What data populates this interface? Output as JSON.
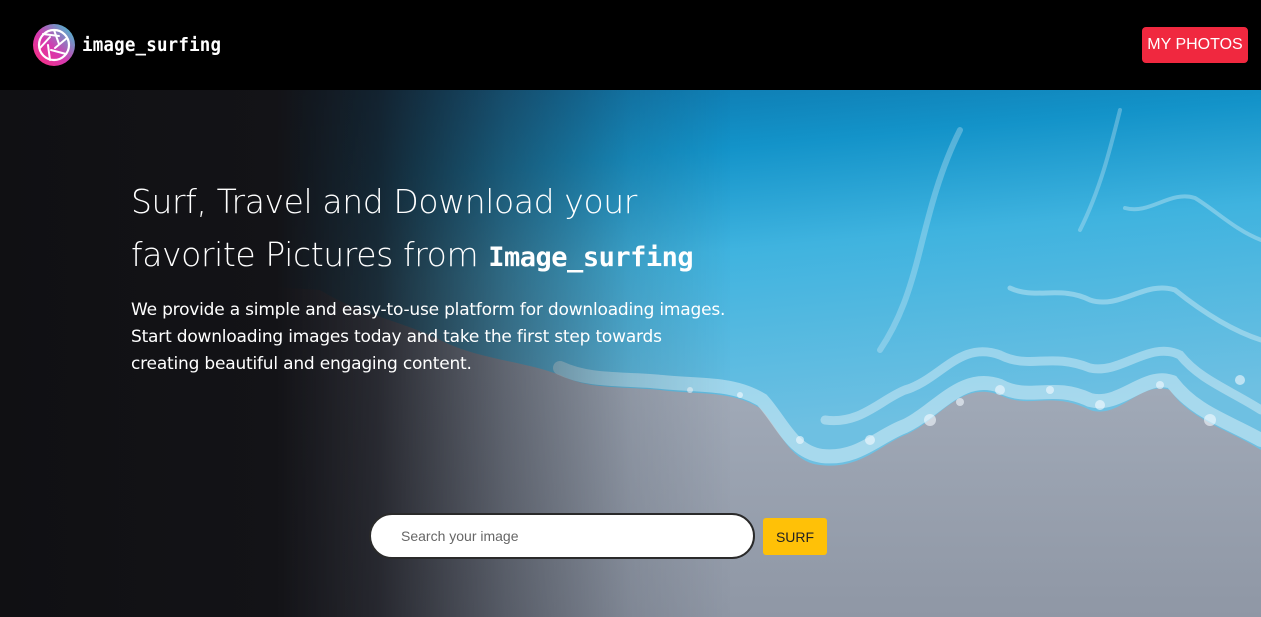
{
  "header": {
    "logo_text": "image_surfing",
    "logo_icon": "camera-aperture-icon",
    "my_photos_label": "MY PHOTOS"
  },
  "hero": {
    "headline_part1": "Surf, Travel and Download your favorite Pictures from ",
    "headline_brand": "Image_surfing",
    "description": "We provide a simple and easy-to-use platform for downloading images. Start downloading images today and take the first step towards creating beautiful and engaging content."
  },
  "search": {
    "placeholder": "Search your image",
    "value": "",
    "button_label": "SURF"
  },
  "colors": {
    "header_bg": "#000000",
    "my_photos_bg": "#f0283f",
    "surf_button_bg": "#ffc107",
    "ocean_blue": "#1a9bd0"
  }
}
